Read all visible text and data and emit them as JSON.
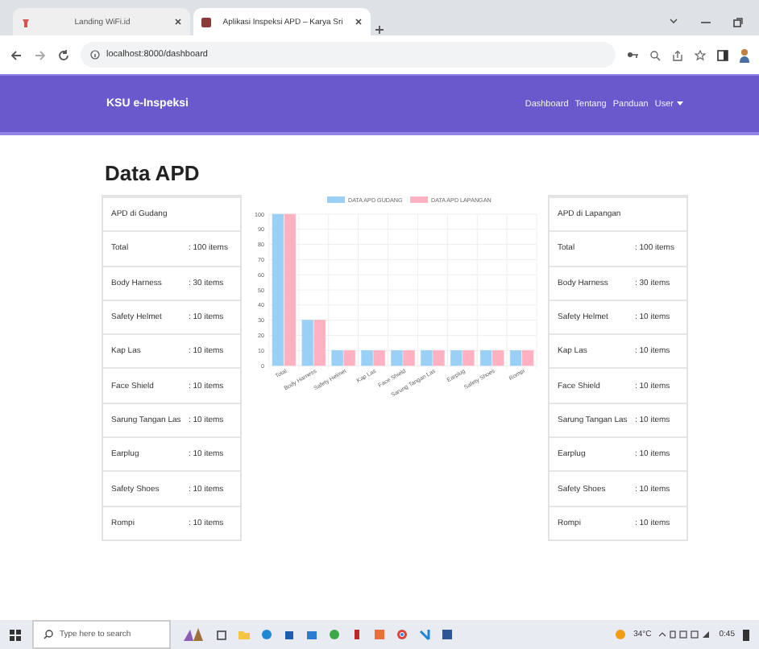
{
  "browser": {
    "tabs": [
      {
        "title": "Landing WiFi.id",
        "selected": false
      },
      {
        "title": "Aplikasi Inspeksi APD – Karya Sri",
        "selected": true
      }
    ],
    "address": "localhost:8000/dashboard"
  },
  "navbar": {
    "brand": "KSU e-Inspeksi",
    "links": [
      "Dashboard",
      "Tentang",
      "Panduan"
    ],
    "user_menu": "User"
  },
  "page": {
    "title": "Data APD",
    "tables": [
      {
        "heading": "APD di Gudang",
        "rows": [
          {
            "item": "Total",
            "amount": ": 100 items"
          },
          {
            "item": "Body Harness",
            "amount": ": 30 items"
          },
          {
            "item": "Safety Helmet",
            "amount": ": 10 items"
          },
          {
            "item": "Kap Las",
            "amount": ": 10 items"
          },
          {
            "item": "Face Shield",
            "amount": ": 10 items"
          },
          {
            "item": "Sarung Tangan Las",
            "amount": ": 10 items"
          },
          {
            "item": "Earplug",
            "amount": ": 10 items"
          },
          {
            "item": "Safety Shoes",
            "amount": ": 10 items"
          },
          {
            "item": "Rompi",
            "amount": ": 10 items"
          }
        ]
      },
      {
        "heading": "APD di Lapangan",
        "rows": [
          {
            "item": "Total",
            "amount": ": 100 items"
          },
          {
            "item": "Body Harness",
            "amount": ": 30 items"
          },
          {
            "item": "Safety Helmet",
            "amount": ": 10 items"
          },
          {
            "item": "Kap Las",
            "amount": ": 10 items"
          },
          {
            "item": "Face Shield",
            "amount": ": 10 items"
          },
          {
            "item": "Sarung Tangan Las",
            "amount": ": 10 items"
          },
          {
            "item": "Earplug",
            "amount": ": 10 items"
          },
          {
            "item": "Safety Shoes",
            "amount": ": 10 items"
          },
          {
            "item": "Rompi",
            "amount": ": 10 items"
          }
        ]
      }
    ],
    "chart_data": {
      "type": "bar",
      "categories": [
        "Total",
        "Body Harness",
        "Safety Helmet",
        "Kap Las",
        "Face Shield",
        "Sarung Tangan Las",
        "Earplug",
        "Safety Shoes",
        "Rompi"
      ],
      "series": [
        {
          "name": "DATA APD GUDANG",
          "color": "#9ad0f5",
          "values": [
            100,
            30,
            10,
            10,
            10,
            10,
            10,
            10,
            10
          ]
        },
        {
          "name": "DATA APD LAPANGAN",
          "color": "#ffb1c1",
          "values": [
            100,
            30,
            10,
            10,
            10,
            10,
            10,
            10,
            10
          ]
        }
      ],
      "grid": true,
      "legend": "top",
      "ylim": [
        0,
        100
      ],
      "yticks": [
        0,
        10,
        20,
        30,
        40,
        50,
        60,
        70,
        80,
        90,
        100
      ]
    }
  },
  "taskbar": {
    "search_placeholder": "Type here to search",
    "weather": "34°C",
    "time": "0:45"
  }
}
